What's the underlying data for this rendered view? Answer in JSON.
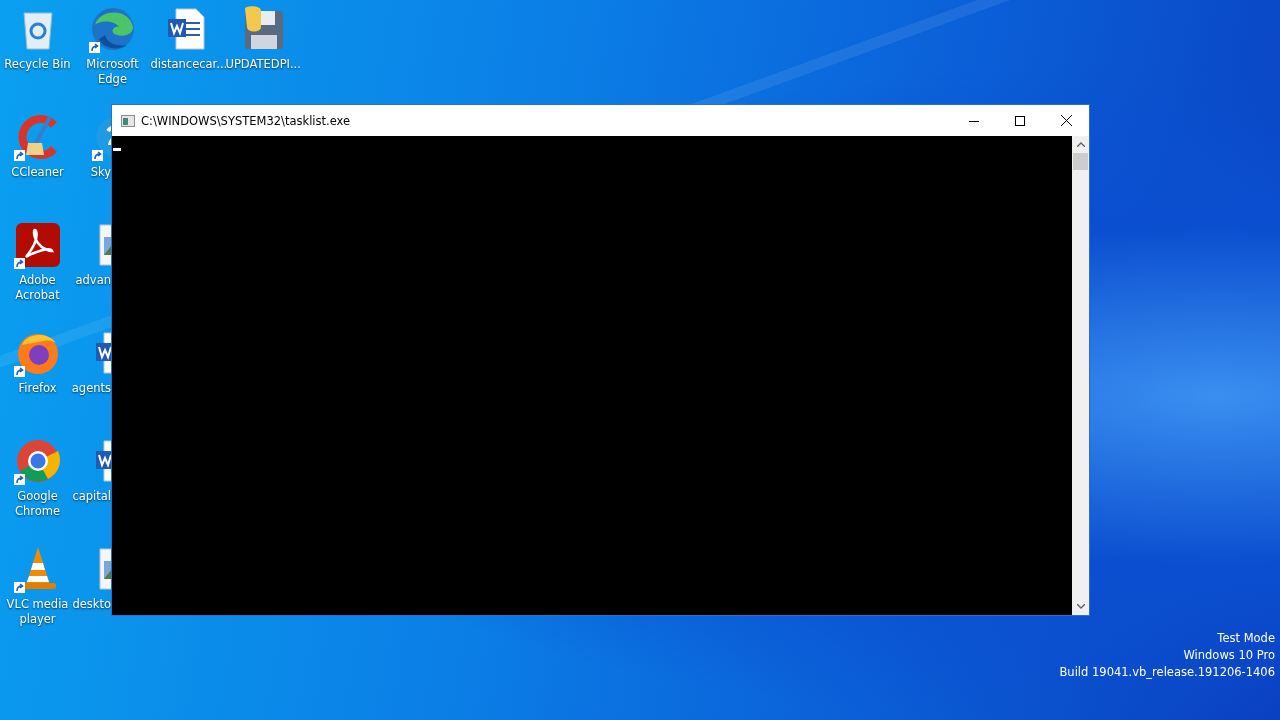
{
  "desktop_icon_rows": [
    [
      {
        "label": "Recycle Bin",
        "kind": "recycle",
        "shortcut": false
      },
      {
        "label": "Microsoft Edge",
        "kind": "edge",
        "shortcut": true
      },
      {
        "label": "distancecar...",
        "kind": "word",
        "shortcut": false
      },
      {
        "label": "UPDATEDPI...",
        "kind": "python-file",
        "shortcut": false
      }
    ],
    [
      {
        "label": "CCleaner",
        "kind": "ccleaner",
        "shortcut": true
      },
      {
        "label": "Sky",
        "kind": "skype",
        "shortcut": true,
        "cut": true
      }
    ],
    [
      {
        "label": "Adobe Acrobat",
        "kind": "acrobat",
        "shortcut": true
      },
      {
        "label": "advan",
        "kind": "image",
        "shortcut": false,
        "cut": true
      }
    ],
    [
      {
        "label": "Firefox",
        "kind": "firefox",
        "shortcut": true
      },
      {
        "label": "agents",
        "kind": "word",
        "shortcut": false,
        "cut": true
      }
    ],
    [
      {
        "label": "Google Chrome",
        "kind": "chrome",
        "shortcut": true
      },
      {
        "label": "capital",
        "kind": "word",
        "shortcut": false,
        "cut": true
      }
    ],
    [
      {
        "label": "VLC media player",
        "kind": "vlc",
        "shortcut": true
      },
      {
        "label": "deskto",
        "kind": "image",
        "shortcut": false,
        "cut": true
      }
    ]
  ],
  "window": {
    "title": "C:\\WINDOWS\\SYSTEM32\\tasklist.exe",
    "cursor": true
  },
  "desktop_info": [
    "Test Mode",
    "Windows 10 Pro",
    "Build 19041.vb_release.191206-1406"
  ]
}
